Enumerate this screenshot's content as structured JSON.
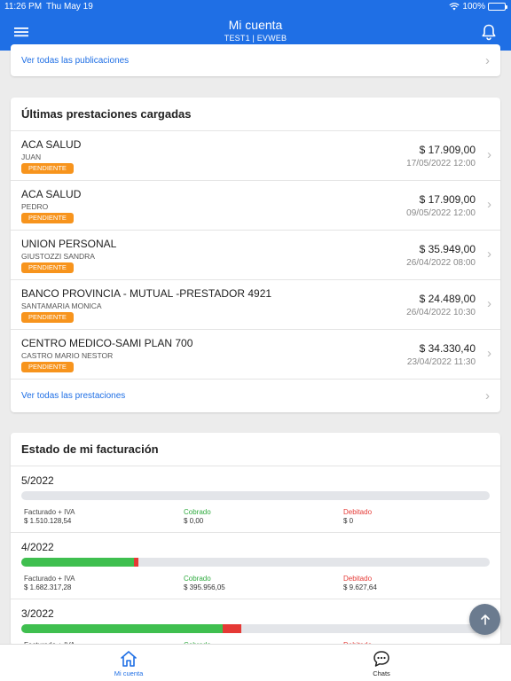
{
  "status": {
    "time": "11:26 PM",
    "date": "Thu May 19",
    "battery": "100%"
  },
  "header": {
    "title": "Mi cuenta",
    "subtitle": "TEST1 | EVWEB"
  },
  "publicaciones": {
    "link": "Ver todas las publicaciones"
  },
  "prestaciones": {
    "title": "Últimas prestaciones cargadas",
    "items": [
      {
        "name": "ACA SALUD",
        "patient": "JUAN",
        "status": "PENDIENTE",
        "amount": "$ 17.909,00",
        "date": "17/05/2022 12:00"
      },
      {
        "name": "ACA SALUD",
        "patient": "PEDRO",
        "status": "PENDIENTE",
        "amount": "$ 17.909,00",
        "date": "09/05/2022 12:00"
      },
      {
        "name": "UNION PERSONAL",
        "patient": "GIUSTOZZI SANDRA",
        "status": "PENDIENTE",
        "amount": "$ 35.949,00",
        "date": "26/04/2022 08:00"
      },
      {
        "name": "BANCO PROVINCIA - MUTUAL -PRESTADOR 4921",
        "patient": "SANTAMARIA MONICA",
        "status": "PENDIENTE",
        "amount": "$ 24.489,00",
        "date": "26/04/2022 10:30"
      },
      {
        "name": "CENTRO MEDICO-SAMI PLAN 700",
        "patient": "CASTRO MARIO NESTOR",
        "status": "PENDIENTE",
        "amount": "$ 34.330,40",
        "date": "23/04/2022 11:30"
      }
    ],
    "link": "Ver todas las prestaciones"
  },
  "facturacion": {
    "title": "Estado de mi facturación",
    "labels": {
      "facturado": "Facturado + IVA",
      "cobrado": "Cobrado",
      "debitado": "Debitado"
    },
    "periods": [
      {
        "period": "5/2022",
        "facturado": "$ 1.510.128,54",
        "cobrado": "$ 0,00",
        "debitado": "$ 0",
        "cobrado_fraction": 0,
        "debitado_fraction": 0
      },
      {
        "period": "4/2022",
        "facturado": "$ 1.682.317,28",
        "cobrado": "$ 395.956,05",
        "debitado": "$ 9.627,64",
        "cobrado_fraction": 0.24,
        "debitado_fraction": 0.01
      },
      {
        "period": "3/2022",
        "cobrado_fraction": 0.43,
        "debitado_fraction": 0.04
      }
    ]
  },
  "colors": {
    "primary": "#1f6fe5",
    "pending": "#f7941d",
    "paid": "#3fbf4f",
    "debited": "#e53935"
  },
  "icons": {
    "menu": "menu-icon",
    "bell": "bell-icon",
    "chevron": "chevron-right-icon",
    "fab": "arrow-up-icon",
    "home": "home-icon",
    "chats": "chat-bubble-icon"
  },
  "nav": {
    "home_label": "Mi cuenta",
    "chats_label": "Chats"
  }
}
